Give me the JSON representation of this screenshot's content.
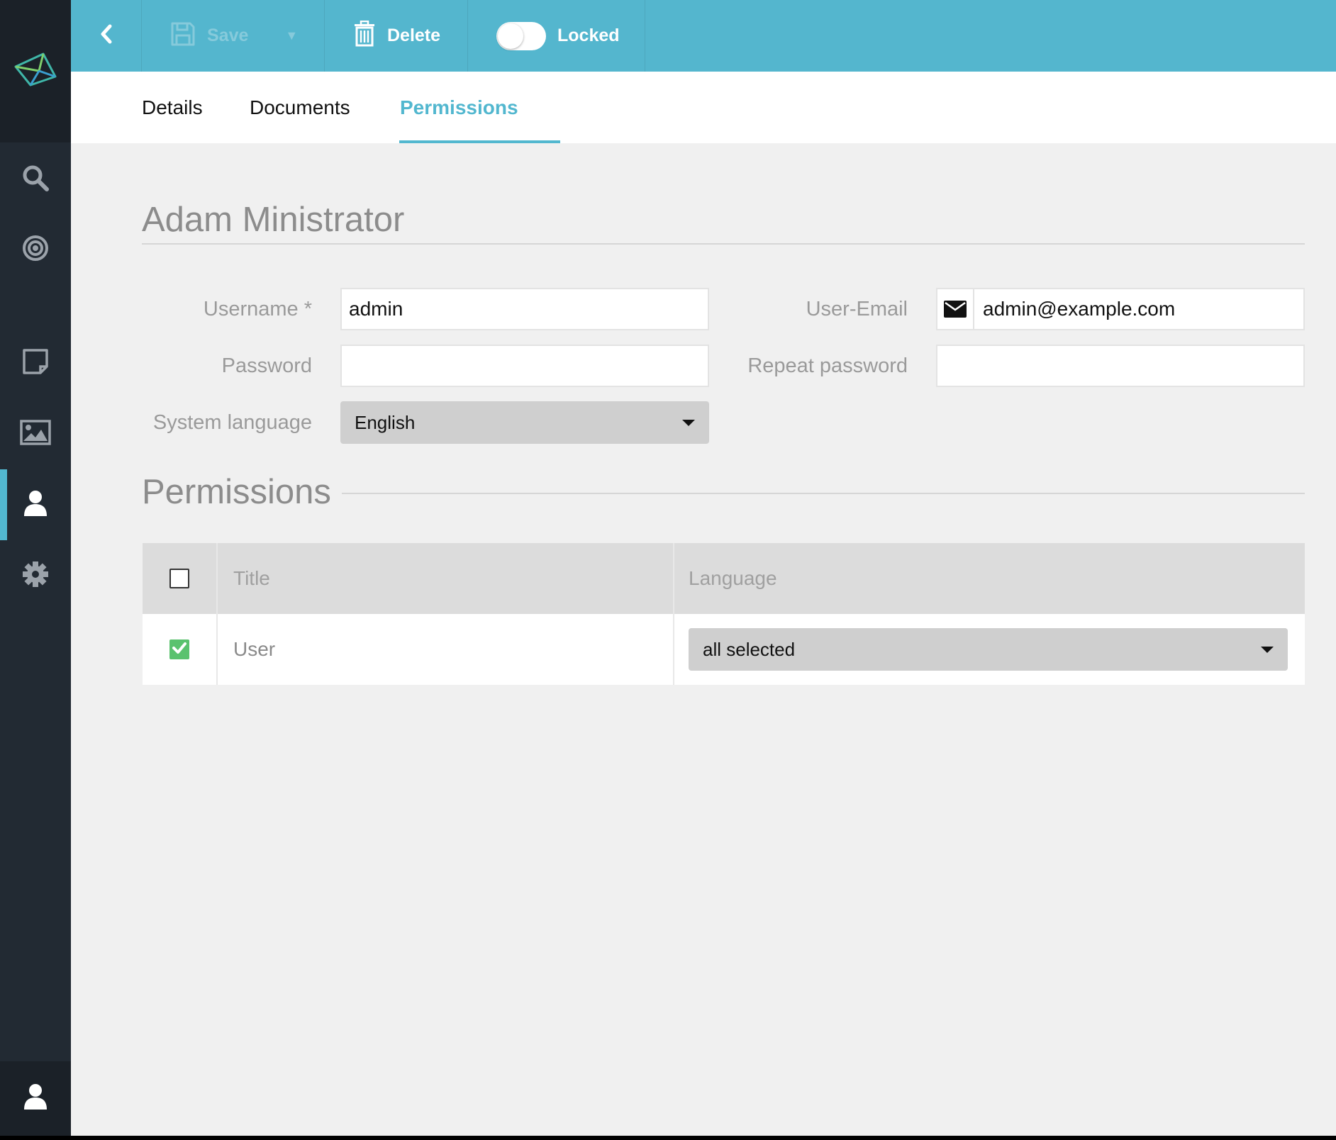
{
  "toolbar": {
    "save_label": "Save",
    "delete_label": "Delete",
    "locked_label": "Locked",
    "locked_on": false
  },
  "tabs": [
    {
      "label": "Details"
    },
    {
      "label": "Documents"
    },
    {
      "label": "Permissions",
      "active": true
    }
  ],
  "user": {
    "full_name": "Adam Ministrator"
  },
  "form": {
    "username_label": "Username *",
    "username_value": "admin",
    "email_label": "User-Email",
    "email_value": "admin@example.com",
    "password_label": "Password",
    "password_value": "",
    "repeat_password_label": "Repeat password",
    "repeat_password_value": "",
    "language_label": "System language",
    "language_value": "English"
  },
  "permissions": {
    "section_title": "Permissions",
    "columns": {
      "title": "Title",
      "language": "Language"
    },
    "header_checked": false,
    "rows": [
      {
        "checked": true,
        "title": "User",
        "language": "all selected"
      }
    ]
  },
  "icons": {
    "logo": "logo-icon",
    "nav": [
      "search-icon",
      "target-icon",
      "note-icon",
      "image-icon",
      "user-icon",
      "gear-icon"
    ],
    "bottom": "user-icon"
  },
  "colors": {
    "accent": "#52b7cf",
    "toolbar": "#54b6ce",
    "sidebar": "#222a33",
    "check_green": "#5ac26e"
  }
}
